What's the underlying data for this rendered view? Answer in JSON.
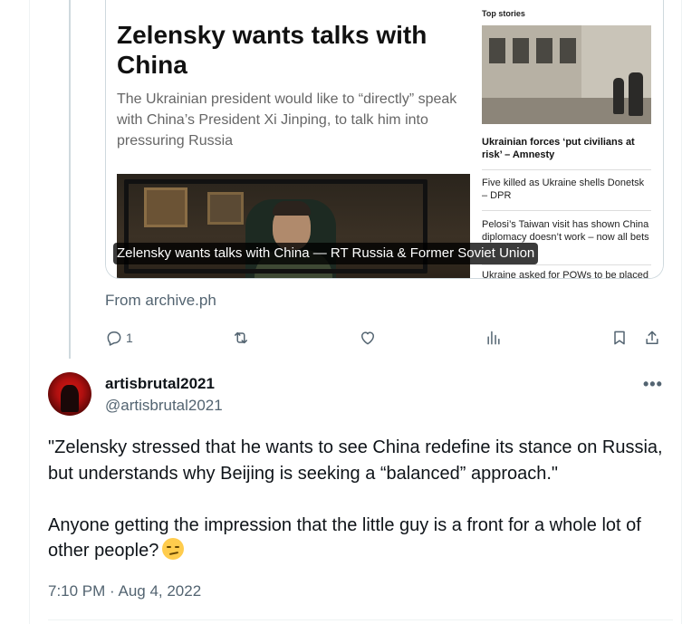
{
  "quoted_preview": {
    "article_title": "Zelensky wants talks with China",
    "article_subtitle": "The Ukrainian president would like to “directly” speak with China’s President Xi Jinping, to talk him into pressuring Russia",
    "caption": "Zelensky wants talks with China — RT Russia & Former Soviet Union",
    "sidebar": {
      "header": "Top stories",
      "lead_headline": "Ukrainian forces ‘put civilians at risk’ – Amnesty",
      "items": [
        "Five killed as Ukraine shells Donetsk – DPR",
        "Pelosi’s Taiwan visit has shown China diplomacy doesn’t work – now all bets",
        "Ukraine asked for POWs to be placed"
      ]
    },
    "source": "From archive.ph"
  },
  "actions": {
    "reply_count": "1",
    "icons": [
      "reply-icon",
      "retweet-icon",
      "like-icon",
      "views-icon",
      "bookmark-icon",
      "share-icon"
    ]
  },
  "tweet": {
    "display_name": "artisbrutal2021",
    "handle": "@artisbrutal2021",
    "more_label": "•••",
    "text_part1": "\"Zelensky stressed that he wants to see China redefine its stance on Russia, but understands why Beijing is seeking a “balanced” approach.\"\n\nAnyone getting the impression that the little guy is a front for a whole lot of other people?",
    "emoji": "smirking-face",
    "timestamp": "7:10 PM · Aug 4, 2022"
  },
  "colors": {
    "text_primary": "#0f1419",
    "text_secondary": "#536471",
    "border": "#cfd9de",
    "avatar_red": "#d81a12"
  }
}
